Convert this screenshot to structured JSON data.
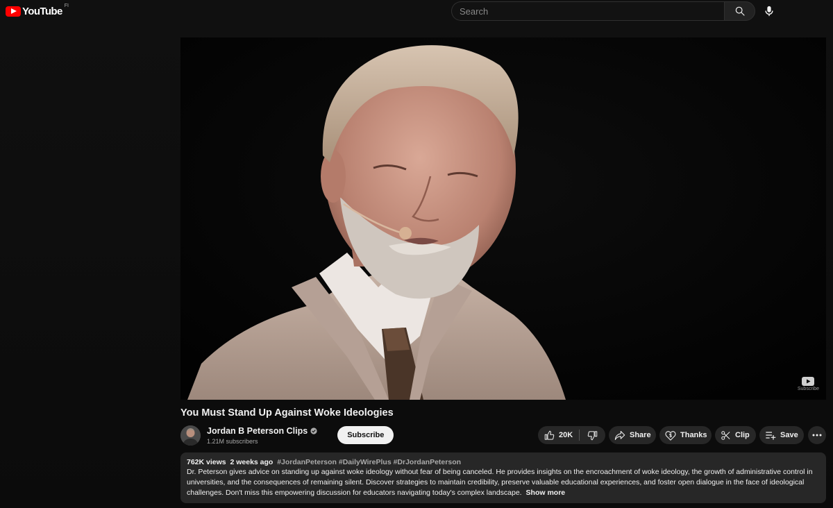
{
  "header": {
    "logo_text": "YouTube",
    "region_code": "FI",
    "search_placeholder": "Search"
  },
  "player": {
    "watermark_label": "Subscribe"
  },
  "video": {
    "title": "You Must Stand Up Against Woke Ideologies"
  },
  "channel": {
    "name": "Jordan B Peterson Clips",
    "subscribers": "1.21M subscribers",
    "subscribe_label": "Subscribe"
  },
  "actions": {
    "likes": "20K",
    "share_label": "Share",
    "thanks_label": "Thanks",
    "clip_label": "Clip",
    "save_label": "Save"
  },
  "description": {
    "views": "762K views",
    "age": "2 weeks ago",
    "hashtags": "#JordanPeterson #DailyWirePlus #DrJordanPeterson",
    "text": "Dr. Peterson gives advice on standing up against woke ideology without fear of being canceled. He provides insights on the encroachment of woke ideology, the growth of administrative control in universities, and the consequences of remaining silent. Discover strategies to maintain credibility, preserve valuable educational experiences, and foster open dialogue in the face of ideological challenges. Don't miss this empowering discussion for educators navigating today's complex landscape.",
    "show_more": "Show more"
  },
  "icons": {
    "logo": "youtube-logo-icon",
    "search": "search-icon",
    "mic": "mic-icon",
    "verified": "verified-check-icon",
    "like": "thumbs-up-icon",
    "dislike": "thumbs-down-icon",
    "share": "share-arrow-icon",
    "thanks": "thanks-heart-dollar-icon",
    "clip": "scissors-icon",
    "save": "playlist-add-icon",
    "more": "more-horizontal-icon"
  },
  "colors": {
    "background": "#0f0f0f",
    "brand_red": "#ff0000",
    "pill_background": "#272727",
    "subscribe_background": "#f1f1f1"
  }
}
